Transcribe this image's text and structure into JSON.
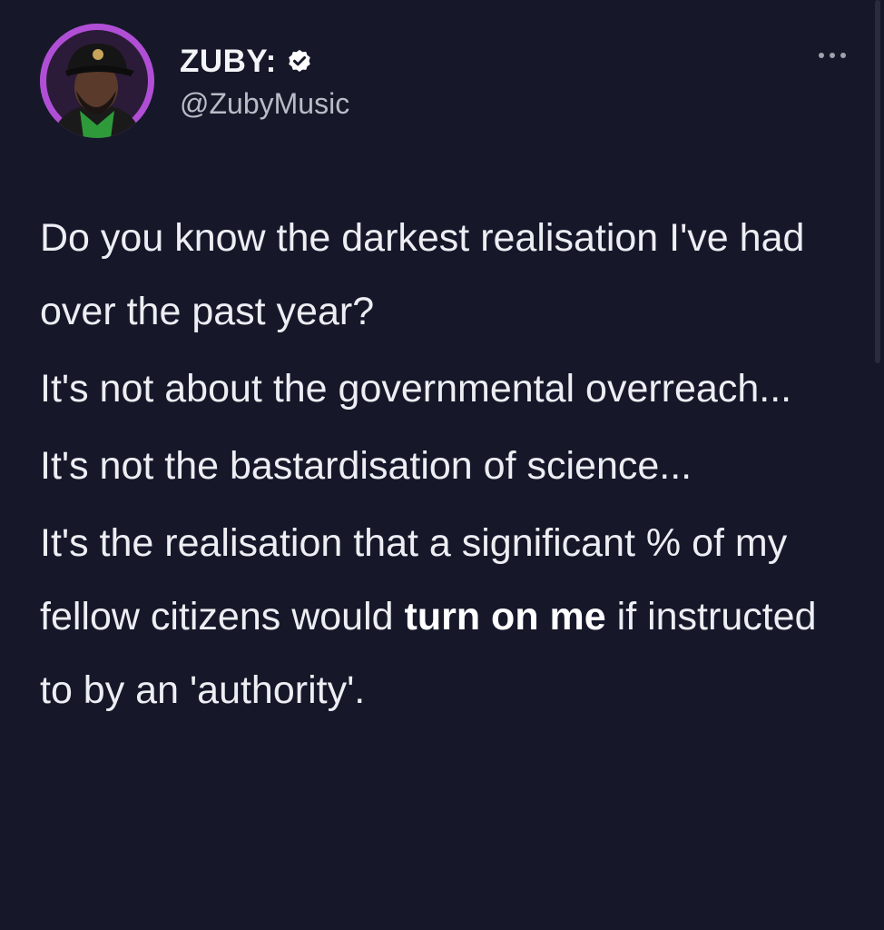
{
  "author": {
    "display_name": "ZUBY:",
    "handle": "@ZubyMusic",
    "verified": true
  },
  "menu": {
    "icon": "more-horizontal-icon"
  },
  "tweet": {
    "paragraphs": [
      {
        "segments": [
          {
            "text": "Do you know the darkest realisation I've had over the past year?"
          }
        ]
      },
      {
        "segments": [
          {
            "text": "It's not about the governmental overreach..."
          }
        ]
      },
      {
        "segments": [
          {
            "text": "It's not the bastardisation of science..."
          }
        ]
      },
      {
        "segments": [
          {
            "text": "It's the realisation that a significant % of my fellow citizens would "
          },
          {
            "text": "turn on me",
            "bold": true
          },
          {
            "text": " if instructed to by an 'authority'."
          }
        ]
      }
    ]
  },
  "colors": {
    "background": "#16182a",
    "avatar_ring": "#b04fd6",
    "verified_badge": "#ffffff"
  }
}
